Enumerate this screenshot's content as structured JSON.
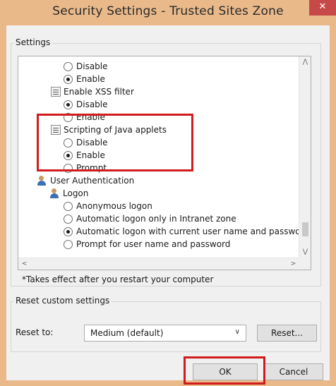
{
  "window": {
    "title": "Security Settings - Trusted Sites Zone",
    "close_glyph": "✕"
  },
  "settings": {
    "group_label": "Settings",
    "rows": [
      {
        "kind": "radio",
        "label": "Disable",
        "checked": false
      },
      {
        "kind": "radio",
        "label": "Enable",
        "checked": true
      },
      {
        "kind": "setting",
        "label": "Enable XSS filter",
        "icon": "setting-icon"
      },
      {
        "kind": "radio",
        "label": "Disable",
        "checked": true
      },
      {
        "kind": "radio",
        "label": "Enable",
        "checked": false
      },
      {
        "kind": "setting",
        "label": "Scripting of Java applets",
        "icon": "setting-icon"
      },
      {
        "kind": "radio",
        "label": "Disable",
        "checked": false
      },
      {
        "kind": "radio",
        "label": "Enable",
        "checked": true
      },
      {
        "kind": "radio",
        "label": "Prompt",
        "checked": false
      },
      {
        "kind": "category",
        "label": "User Authentication",
        "icon": "users-icon"
      },
      {
        "kind": "category",
        "label": "Logon",
        "icon": "users-icon"
      },
      {
        "kind": "radio",
        "label": "Anonymous logon",
        "checked": false
      },
      {
        "kind": "radio",
        "label": "Automatic logon only in Intranet zone",
        "checked": false
      },
      {
        "kind": "radio",
        "label": "Automatic logon with current user name and password",
        "checked": true
      },
      {
        "kind": "radio",
        "label": "Prompt for user name and password",
        "checked": false
      }
    ],
    "note": "*Takes effect after you restart your computer"
  },
  "reset": {
    "group_label": "Reset custom settings",
    "reset_to_label": "Reset to:",
    "selected": "Medium (default)",
    "reset_button": "Reset..."
  },
  "footer": {
    "ok_label": "OK",
    "cancel_label": "Cancel"
  },
  "colors": {
    "title_bar": "#e9b98a",
    "close_button": "#c74848",
    "highlight": "#d01c1c"
  }
}
